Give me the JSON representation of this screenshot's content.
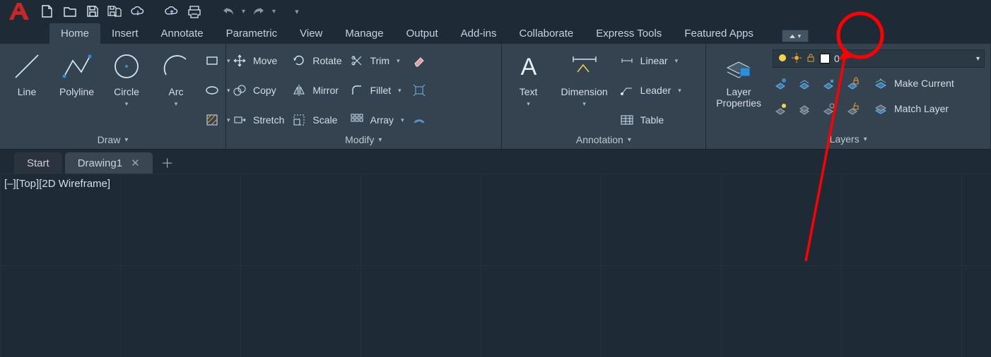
{
  "app": {
    "name": "AutoCAD"
  },
  "qat": {
    "items": [
      "new",
      "open",
      "save",
      "saveas",
      "cloud",
      "export",
      "print"
    ],
    "undo": "undo",
    "redo": "redo",
    "overflow": "overflow"
  },
  "tabs": {
    "items": [
      {
        "id": "home",
        "label": "Home"
      },
      {
        "id": "insert",
        "label": "Insert"
      },
      {
        "id": "annotate",
        "label": "Annotate"
      },
      {
        "id": "parametric",
        "label": "Parametric"
      },
      {
        "id": "view",
        "label": "View"
      },
      {
        "id": "manage",
        "label": "Manage"
      },
      {
        "id": "output",
        "label": "Output"
      },
      {
        "id": "addins",
        "label": "Add-ins"
      },
      {
        "id": "collaborate",
        "label": "Collaborate"
      },
      {
        "id": "express",
        "label": "Express Tools"
      },
      {
        "id": "featured",
        "label": "Featured Apps"
      }
    ],
    "active": "home"
  },
  "panels": {
    "draw": {
      "title": "Draw",
      "tools": [
        "Line",
        "Polyline",
        "Circle",
        "Arc"
      ]
    },
    "modify": {
      "title": "Modify",
      "tools": {
        "move": "Move",
        "copy": "Copy",
        "stretch": "Stretch",
        "rotate": "Rotate",
        "mirror": "Mirror",
        "scale": "Scale",
        "trim": "Trim",
        "fillet": "Fillet",
        "array": "Array"
      }
    },
    "annotation": {
      "title": "Annotation",
      "tools": {
        "text": "Text",
        "dimension": "Dimension",
        "linear": "Linear",
        "leader": "Leader",
        "table": "Table"
      }
    },
    "layers": {
      "title": "Layers",
      "layerprops": "Layer\nProperties",
      "current_layer": "0",
      "make_current": "Make Current",
      "match_layer": "Match Layer"
    }
  },
  "doc_tabs": {
    "items": [
      {
        "id": "start",
        "label": "Start"
      },
      {
        "id": "drawing1",
        "label": "Drawing1"
      }
    ],
    "active": "drawing1"
  },
  "viewport": {
    "label": "[–][Top][2D Wireframe]"
  },
  "annotation_color": "#ff0000"
}
